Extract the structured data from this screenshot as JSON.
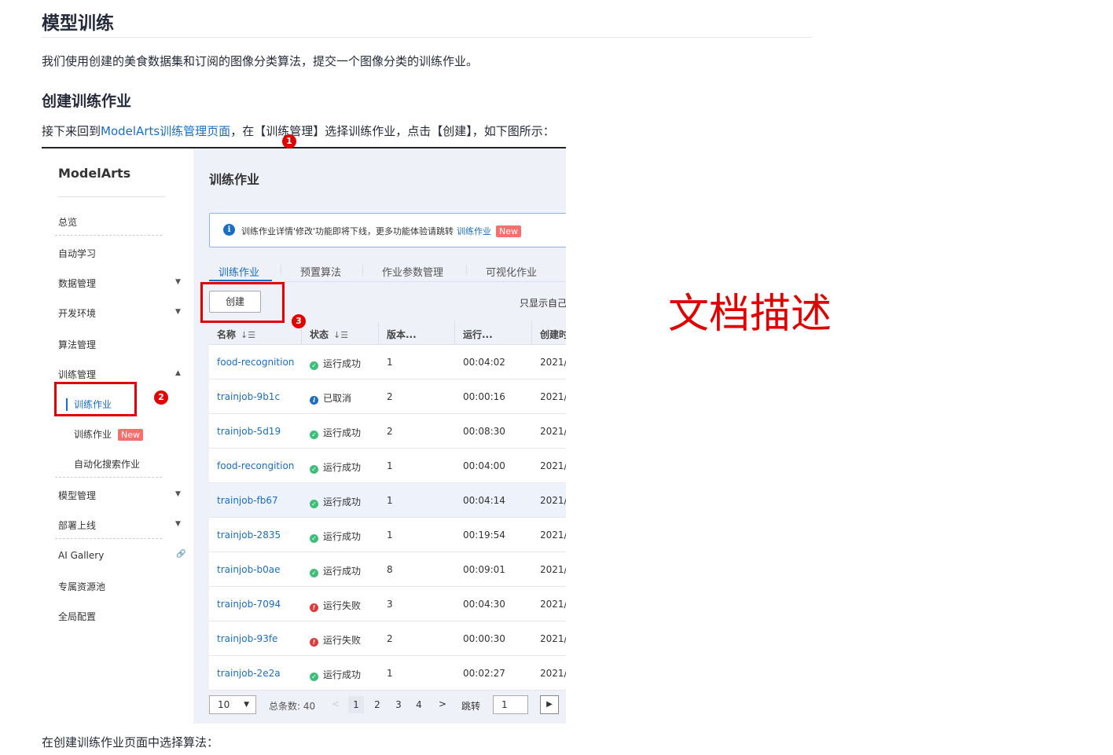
{
  "doc": {
    "h1": "模型训练",
    "p1": "我们使用创建的美食数据集和订阅的图像分类算法，提交一个图像分类的训练作业。",
    "h2": "创建训练作业",
    "p2_before": "接下来回到",
    "p2_link": "ModelArts训练管理页面",
    "p2_after": "，在【训练管理】选择训练作业，点击【创建】，如下图所示：",
    "p3": "在创建训练作业页面中选择算法："
  },
  "sidebar": {
    "logo": "ModelArts",
    "items": {
      "overview": "总览",
      "automl": "自动学习",
      "data": "数据管理",
      "dev": "开发环境",
      "algo": "算法管理",
      "train": "训练管理",
      "train_sub1": "训练作业",
      "train_sub2": "训练作业",
      "train_sub2_badge": "New",
      "train_sub3": "自动化搜索作业",
      "model": "模型管理",
      "deploy": "部署上线",
      "gallery": "AI Gallery",
      "pool": "专属资源池",
      "config": "全局配置"
    }
  },
  "main": {
    "title": "训练作业",
    "notice": "训练作业详情'修改'功能即将下线，更多功能体验请跳转",
    "notice_link": "训练作业",
    "notice_badge": "New",
    "tabs": [
      "训练作业",
      "预置算法",
      "作业参数管理",
      "可视化作业"
    ],
    "create_label": "创建",
    "only_mine": "只显示自己",
    "columns": {
      "name": "名称",
      "status": "状态",
      "version": "版本...",
      "runtime": "运行...",
      "created": "创建时"
    },
    "rows": [
      {
        "name": "food-recognition",
        "status": "运行成功",
        "status_type": "ok",
        "version": "1",
        "runtime": "00:04:02",
        "created": "2021/"
      },
      {
        "name": "trainjob-9b1c",
        "status": "已取消",
        "status_type": "info",
        "version": "2",
        "runtime": "00:00:16",
        "created": "2021/"
      },
      {
        "name": "trainjob-5d19",
        "status": "运行成功",
        "status_type": "ok",
        "version": "2",
        "runtime": "00:08:30",
        "created": "2021/"
      },
      {
        "name": "food-recongition",
        "status": "运行成功",
        "status_type": "ok",
        "version": "1",
        "runtime": "00:04:00",
        "created": "2021/"
      },
      {
        "name": "trainjob-fb67",
        "status": "运行成功",
        "status_type": "ok",
        "version": "1",
        "runtime": "00:04:14",
        "created": "2021/"
      },
      {
        "name": "trainjob-2835",
        "status": "运行成功",
        "status_type": "ok",
        "version": "1",
        "runtime": "00:19:54",
        "created": "2021/"
      },
      {
        "name": "trainjob-b0ae",
        "status": "运行成功",
        "status_type": "ok",
        "version": "8",
        "runtime": "00:09:01",
        "created": "2021/"
      },
      {
        "name": "trainjob-7094",
        "status": "运行失败",
        "status_type": "err",
        "version": "3",
        "runtime": "00:04:30",
        "created": "2021/"
      },
      {
        "name": "trainjob-93fe",
        "status": "运行失败",
        "status_type": "err",
        "version": "2",
        "runtime": "00:00:30",
        "created": "2021/"
      },
      {
        "name": "trainjob-2e2a",
        "status": "运行成功",
        "status_type": "ok",
        "version": "1",
        "runtime": "00:02:27",
        "created": "2021/"
      }
    ],
    "pager": {
      "page_size": "10",
      "total": "总条数: 40",
      "pages": [
        "1",
        "2",
        "3",
        "4"
      ],
      "current_page": "1",
      "jump_label": "跳转",
      "jump_value": "1"
    }
  },
  "annotations": {
    "marker1": "1",
    "marker2": "2",
    "marker3": "3",
    "overlay": "文档描述"
  },
  "colors": {
    "link": "#1a6ec2",
    "highlight": "#e00000",
    "success": "#3dbf7a",
    "error": "#e03a3a",
    "badge": "#f66f6a"
  }
}
